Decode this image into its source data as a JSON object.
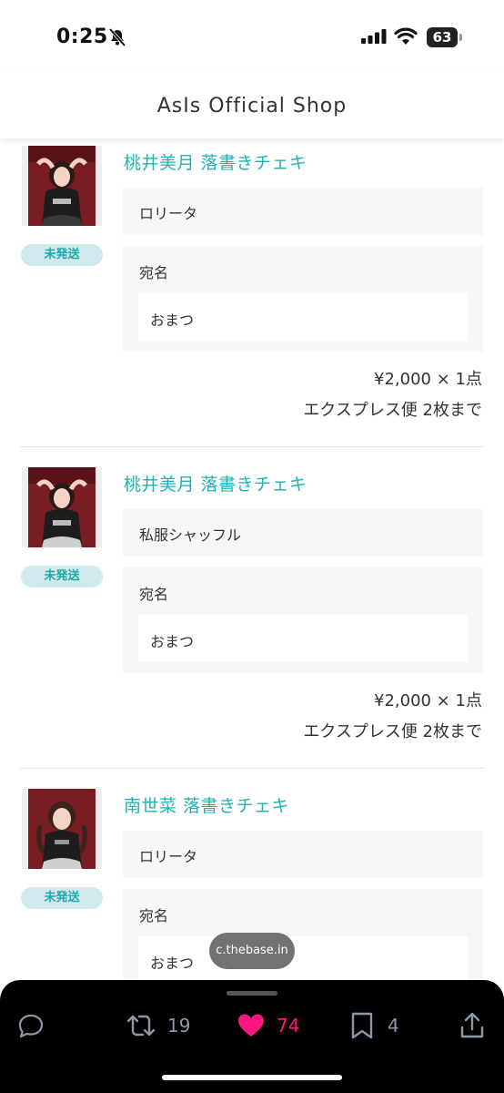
{
  "status_bar": {
    "time": "0:25",
    "battery": "63"
  },
  "header": {
    "title": "AsIs Official Shop"
  },
  "orders": [
    {
      "item_name": "桃井美月 落書きチェキ",
      "status": "未発送",
      "option": "ロリータ",
      "address_label": "宛名",
      "address_value": "おまつ",
      "price": "¥2,000 × 1点",
      "shipping": "エクスプレス便 2枚まで"
    },
    {
      "item_name": "桃井美月 落書きチェキ",
      "status": "未発送",
      "option": "私服シャッフル",
      "address_label": "宛名",
      "address_value": "おまつ",
      "price": "¥2,000 × 1点",
      "shipping": "エクスプレス便 2枚まで"
    },
    {
      "item_name": "南世菜 落書きチェキ",
      "status": "未発送",
      "option": "ロリータ",
      "address_label": "宛名",
      "address_value": "おまつ"
    }
  ],
  "url_chip": "c.thebase.in",
  "actions": {
    "retweets": "19",
    "likes": "74",
    "bookmarks": "4"
  },
  "colors": {
    "accent": "#1fb3b3",
    "status_pill_bg": "#cfe9ec",
    "like": "#f91880",
    "action_bar": "#000000"
  },
  "icons": [
    "bell-slash-icon",
    "signal-icon",
    "wifi-icon",
    "battery-icon",
    "reply-icon",
    "retweet-icon",
    "heart-icon",
    "bookmark-icon",
    "share-icon"
  ]
}
